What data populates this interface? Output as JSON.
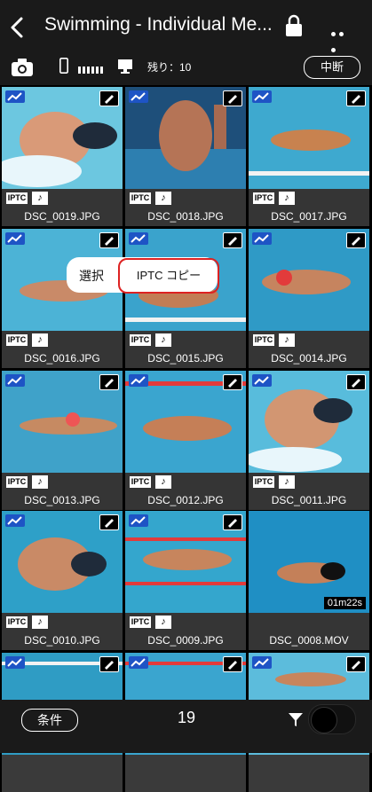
{
  "header": {
    "title": "Swimming - Individual Me...",
    "back_icon": "chevron-left-icon",
    "lock_icon": "lock-icon",
    "more_icon": "more-dots-icon"
  },
  "status_bar": {
    "remaining_label": "残り：10",
    "interrupt_label": "中断"
  },
  "popup": {
    "select_label": "選択",
    "iptc_copy_label": "IPTC コピー"
  },
  "grid": {
    "items": [
      {
        "filename": "DSC_0019.JPG"
      },
      {
        "filename": "DSC_0018.JPG"
      },
      {
        "filename": "DSC_0017.JPG"
      },
      {
        "filename": "DSC_0016.JPG"
      },
      {
        "filename": "DSC_0015.JPG"
      },
      {
        "filename": "DSC_0014.JPG"
      },
      {
        "filename": "DSC_0013.JPG"
      },
      {
        "filename": "DSC_0012.JPG"
      },
      {
        "filename": "DSC_0011.JPG"
      },
      {
        "filename": "DSC_0010.JPG"
      },
      {
        "filename": "DSC_0009.JPG"
      },
      {
        "filename": "DSC_0008.MOV",
        "duration": "01m22s"
      },
      {
        "filename": ""
      },
      {
        "filename": ""
      },
      {
        "filename": ""
      }
    ],
    "iptc_badge": "IPTC",
    "note_badge": "♪"
  },
  "footer": {
    "conditions_label": "条件",
    "count": "19"
  },
  "colors": {
    "accent_blue": "#1e54c5",
    "highlight_red": "#d22222"
  }
}
